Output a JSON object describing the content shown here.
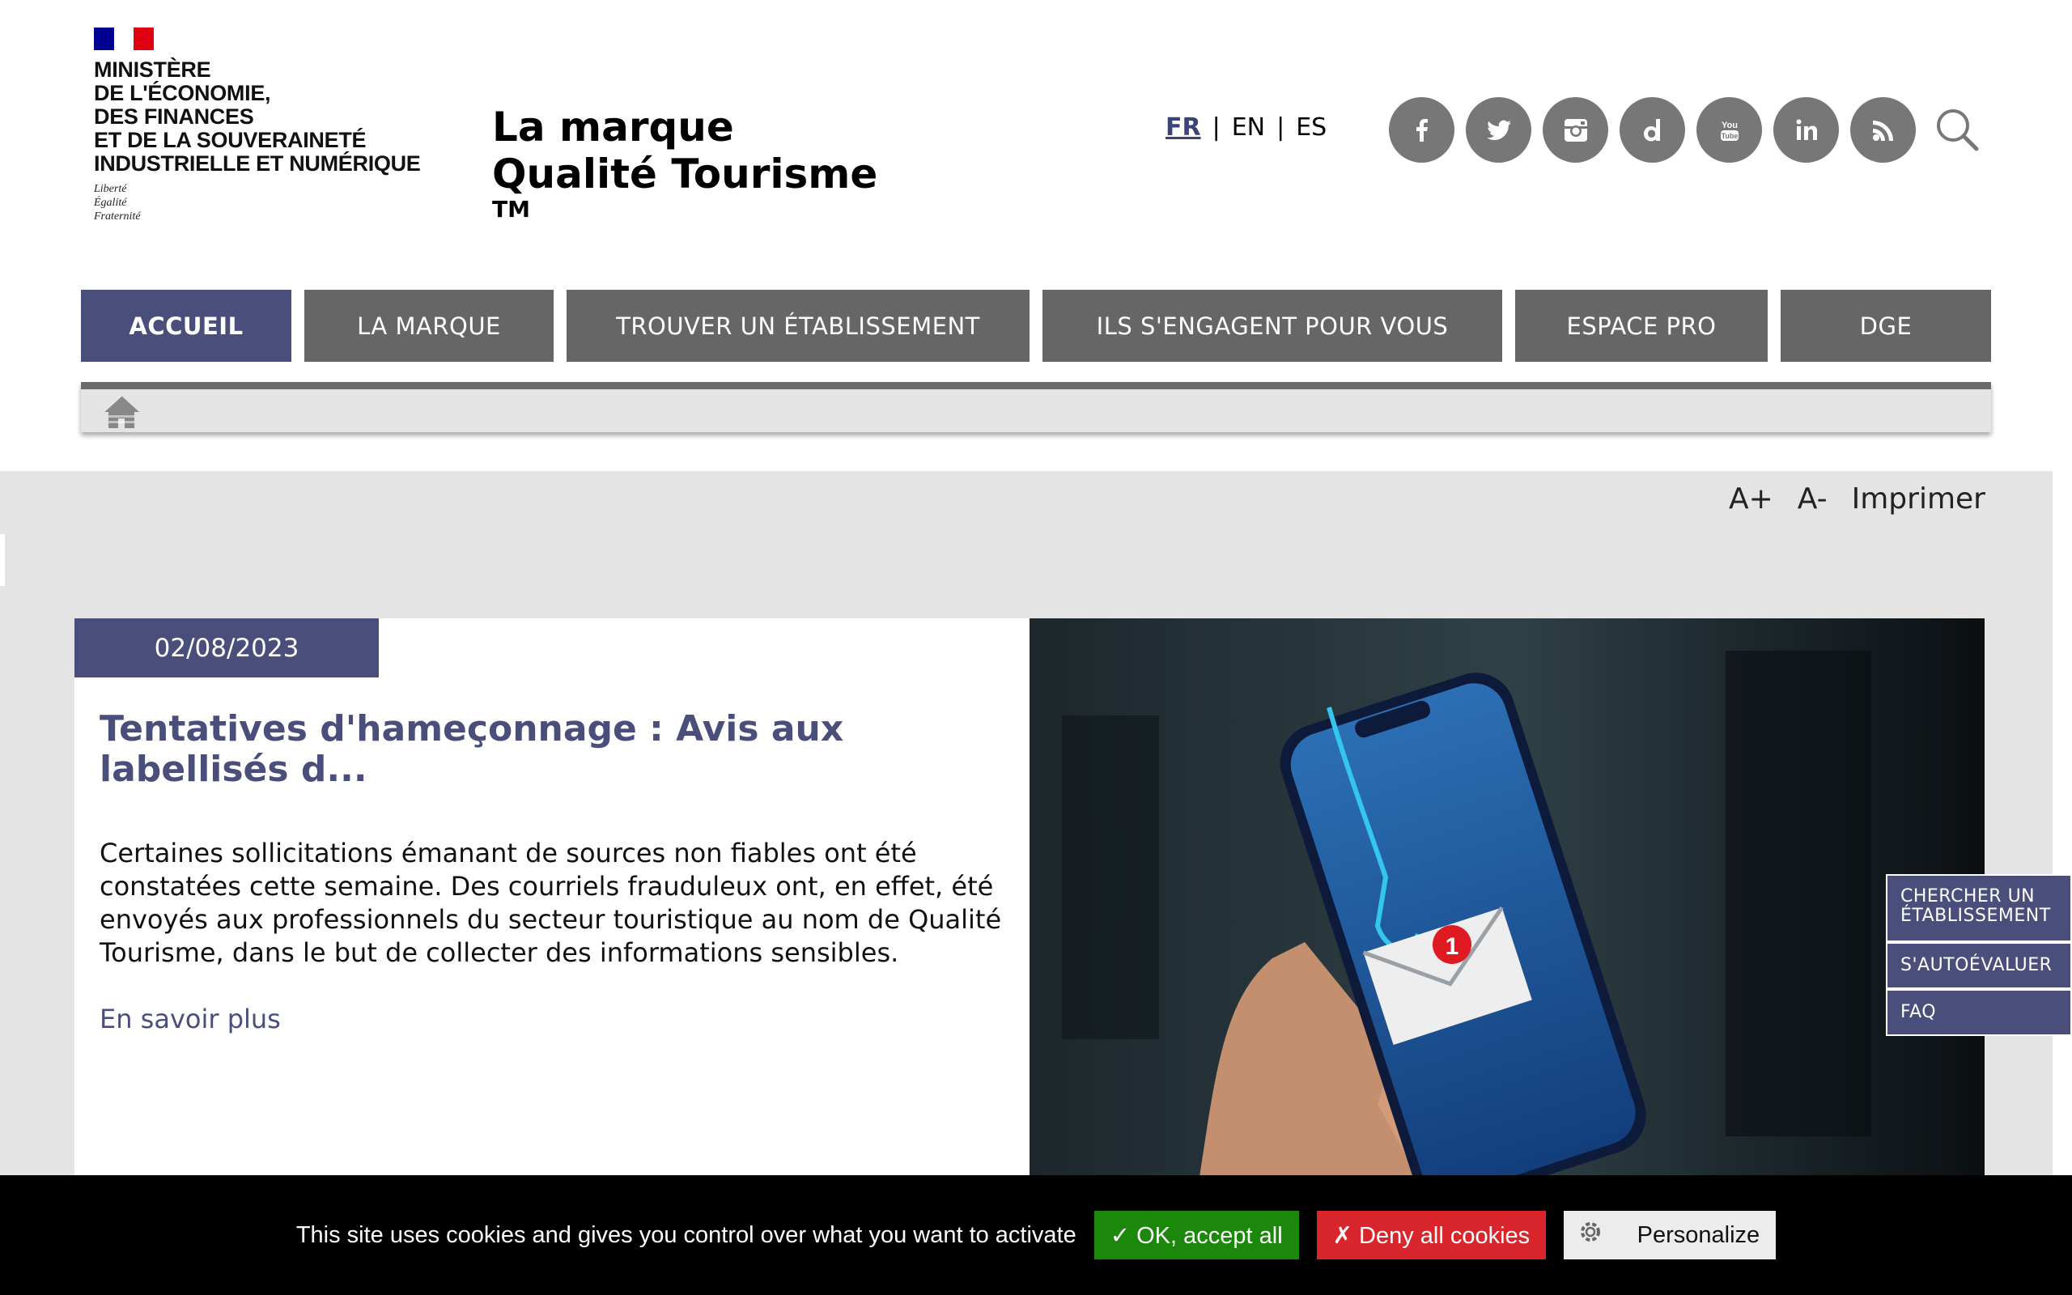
{
  "header": {
    "ministry_lines": "MINISTÈRE\nDE L'ÉCONOMIE,\nDES FINANCES\nET DE LA SOUVERAINETÉ\nINDUSTRIELLE ET NUMÉRIQUE",
    "motto": "Liberté\nÉgalité\nFraternité",
    "brand_title": "La marque\nQualité Tourisme",
    "brand_tm": "TM",
    "languages": [
      {
        "label": "FR",
        "active": true
      },
      {
        "label": "EN",
        "active": false
      },
      {
        "label": "ES",
        "active": false
      }
    ],
    "lang_separator": "|",
    "social_icons": [
      "facebook-icon",
      "twitter-icon",
      "instagram-icon",
      "dailymotion-icon",
      "youtube-icon",
      "linkedin-icon",
      "rss-icon"
    ],
    "colors": {
      "accent": "#4a4e7a",
      "social": "#777777",
      "flag_blue": "#000091",
      "flag_red": "#e1000f"
    }
  },
  "nav": {
    "items": [
      {
        "label": "ACCUEIL",
        "active": true
      },
      {
        "label": "LA MARQUE",
        "active": false
      },
      {
        "label": "TROUVER UN ÉTABLISSEMENT",
        "active": false
      },
      {
        "label": "ILS S'ENGAGENT POUR VOUS",
        "active": false
      },
      {
        "label": "ESPACE PRO",
        "active": false
      },
      {
        "label": "DGE",
        "active": false
      }
    ]
  },
  "tools": {
    "font_plus": "A+",
    "font_minus": "A-",
    "print": "Imprimer"
  },
  "news": {
    "date": "02/08/2023",
    "title": "Tentatives d'hameçonnage : Avis aux labellisés d...",
    "text": "Certaines sollicitations émanant de sources non fiables ont été constatées cette semaine. Des courriels frauduleux ont, en effet, été envoyés aux professionnels du secteur touristique au nom de Qualité Tourisme, dans le but de collecter des informations sensibles.",
    "more": "En savoir plus",
    "image_badge": "1"
  },
  "side_menu": {
    "find": "CHERCHER UN\nÉTABLISSEMENT",
    "self_eval": "S'AUTOÉVALUER",
    "faq": "FAQ"
  },
  "cookie": {
    "message": "This site uses cookies and gives you control over what you want to activate",
    "accept": "✓ OK, accept all",
    "deny": "✗ Deny all cookies",
    "personalize": "Personalize"
  }
}
